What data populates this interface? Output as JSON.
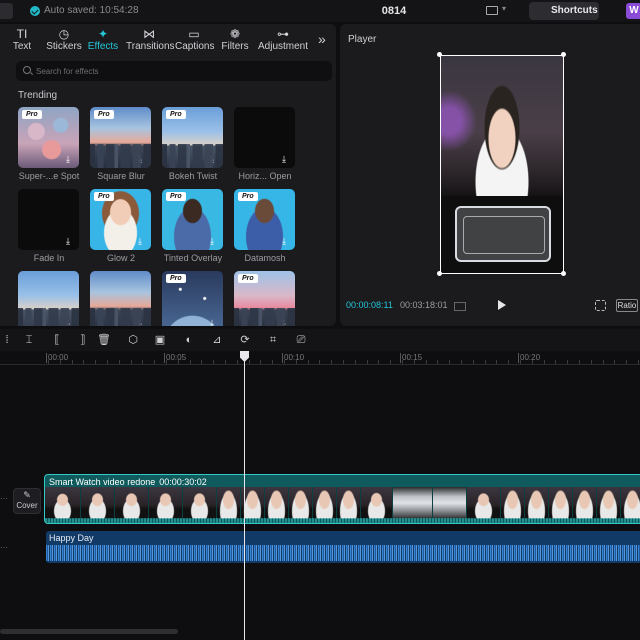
{
  "topbar": {
    "saved_status": "Auto saved: 10:54:28",
    "project_name": "0814",
    "shortcuts_label": "Shortcuts",
    "avatar_letter": "W"
  },
  "tabs": [
    {
      "label": "Text",
      "glyph": "TI",
      "icon": "text-icon"
    },
    {
      "label": "Stickers",
      "glyph": "◷",
      "icon": "stickers-icon"
    },
    {
      "label": "Effects",
      "glyph": "✦",
      "icon": "effects-icon",
      "active": true
    },
    {
      "label": "Transitions",
      "glyph": "⋈",
      "icon": "transitions-icon"
    },
    {
      "label": "Captions",
      "glyph": "▭",
      "icon": "captions-icon"
    },
    {
      "label": "Filters",
      "glyph": "❁",
      "icon": "filters-icon"
    },
    {
      "label": "Adjustment",
      "glyph": "⊶",
      "icon": "adjustment-icon"
    }
  ],
  "more_glyph": "»",
  "search": {
    "placeholder": "Search for effects"
  },
  "section_title": "Trending",
  "effects": [
    {
      "label": "Super-...e Spot",
      "pro": true,
      "theme": "bokeh"
    },
    {
      "label": "Square Blur",
      "pro": true,
      "theme": "city-warm"
    },
    {
      "label": "Bokeh Twist",
      "pro": true,
      "theme": "city"
    },
    {
      "label": "Horiz... Open",
      "pro": false,
      "theme": "black"
    },
    {
      "label": "Fade In",
      "pro": false,
      "theme": "black"
    },
    {
      "label": "Glow 2",
      "pro": true,
      "theme": "woman"
    },
    {
      "label": "Tinted Overlay",
      "pro": true,
      "theme": "man"
    },
    {
      "label": "Datamosh",
      "pro": true,
      "theme": "man-color"
    },
    {
      "label": "",
      "pro": false,
      "theme": "city"
    },
    {
      "label": "",
      "pro": false,
      "theme": "city-warm"
    },
    {
      "label": "",
      "pro": true,
      "theme": "space"
    },
    {
      "label": "",
      "pro": true,
      "theme": "pink"
    }
  ],
  "pro_badge": "Pro",
  "player": {
    "title": "Player",
    "current_time": "00:00:08:11",
    "total_time": "00:03:18:01",
    "ratio_label": "Ratio"
  },
  "toolbar_tools": [
    {
      "glyph": "⁞",
      "icon": "select-icon"
    },
    {
      "glyph": "⌶",
      "icon": "split-icon"
    },
    {
      "glyph": "⟦",
      "icon": "split-left-icon"
    },
    {
      "glyph": "⟧",
      "icon": "split-right-icon"
    },
    {
      "glyph": "🗑",
      "icon": "delete-icon"
    },
    {
      "glyph": "⬡",
      "icon": "mask-icon"
    },
    {
      "glyph": "▣",
      "icon": "freeze-icon"
    },
    {
      "glyph": "◐",
      "icon": "reverse-icon"
    },
    {
      "glyph": "⊿",
      "icon": "mirror-icon"
    },
    {
      "glyph": "⟳",
      "icon": "rotate-icon"
    },
    {
      "glyph": "⌗",
      "icon": "crop-icon"
    },
    {
      "glyph": "⎚",
      "icon": "subtitle-icon"
    }
  ],
  "ruler": [
    "00:00",
    "00:05",
    "00:10",
    "00:15",
    "00:20"
  ],
  "cover_label": "Cover",
  "video_clip": {
    "title": "Smart Watch video redone",
    "duration": "00:00:30:02"
  },
  "audio_clip": {
    "title": "Happy Day"
  }
}
